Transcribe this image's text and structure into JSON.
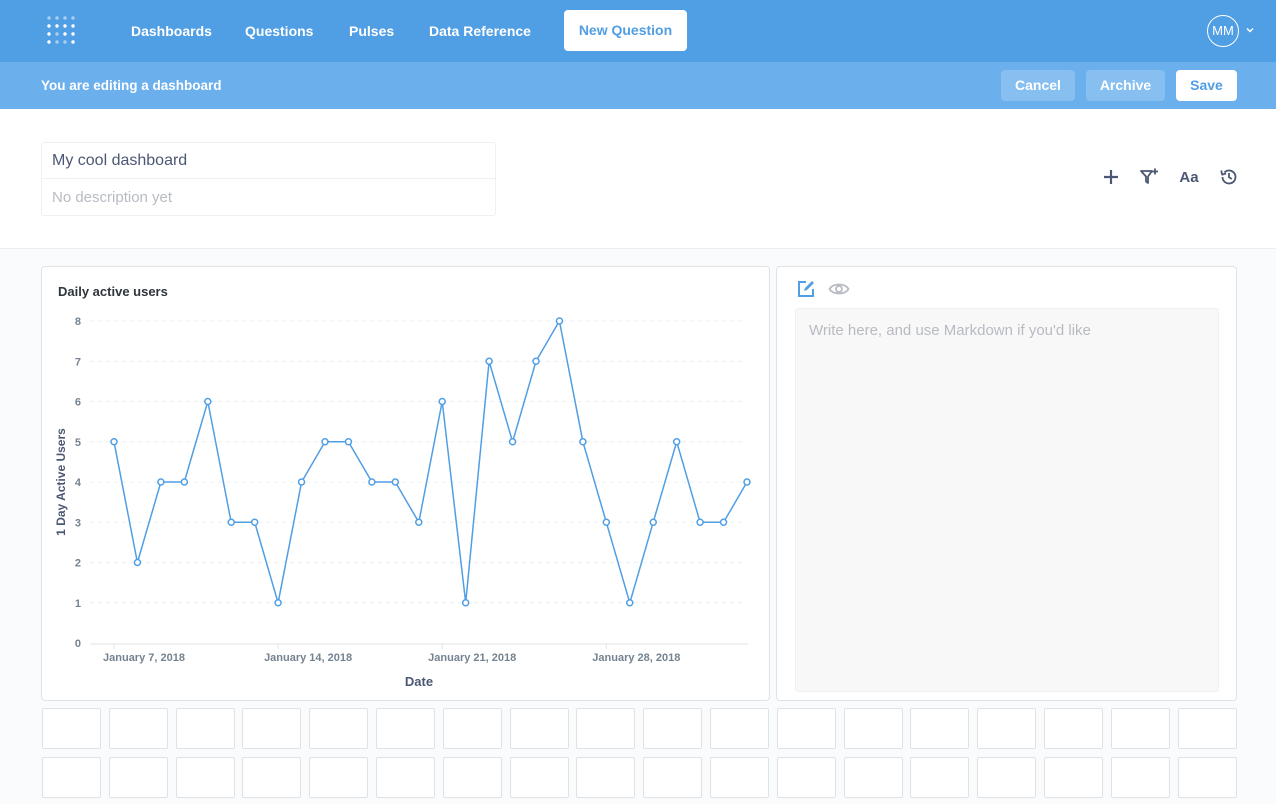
{
  "nav": {
    "links": [
      "Dashboards",
      "Questions",
      "Pulses",
      "Data Reference"
    ],
    "new_question": "New Question",
    "avatar_initials": "MM"
  },
  "editbar": {
    "message": "You are editing a dashboard",
    "cancel": "Cancel",
    "archive": "Archive",
    "save": "Save"
  },
  "header": {
    "title": "My cool dashboard",
    "description_placeholder": "No description yet",
    "text_tool_label": "Aa",
    "icons": [
      "plus-icon",
      "filter-add-icon",
      "text-icon",
      "history-icon"
    ]
  },
  "markdown_card": {
    "placeholder": "Write here, and use Markdown if you'd like"
  },
  "colors": {
    "brand": "#509ee3",
    "editbar": "#6cafed",
    "line": "#509ee3"
  },
  "chart_data": {
    "type": "line",
    "title": "Daily active users",
    "xlabel": "Date",
    "ylabel": "1 Day Active Users",
    "ylim": [
      0,
      8
    ],
    "yticks": [
      0,
      1,
      2,
      3,
      4,
      5,
      6,
      7,
      8
    ],
    "xtick_labels": [
      "January 7, 2018",
      "January 14, 2018",
      "January 21, 2018",
      "January 28, 2018"
    ],
    "x": [
      "2018-01-07",
      "2018-01-08",
      "2018-01-09",
      "2018-01-10",
      "2018-01-11",
      "2018-01-12",
      "2018-01-13",
      "2018-01-14",
      "2018-01-15",
      "2018-01-16",
      "2018-01-17",
      "2018-01-18",
      "2018-01-19",
      "2018-01-20",
      "2018-01-21",
      "2018-01-22",
      "2018-01-23",
      "2018-01-24",
      "2018-01-25",
      "2018-01-26",
      "2018-01-27",
      "2018-01-28",
      "2018-01-29",
      "2018-01-30",
      "2018-01-31",
      "2018-02-01",
      "2018-02-02",
      "2018-02-03"
    ],
    "values": [
      5,
      2,
      4,
      4,
      6,
      3,
      3,
      1,
      4,
      5,
      5,
      4,
      4,
      3,
      6,
      1,
      7,
      5,
      7,
      8,
      5,
      3,
      1,
      3,
      5,
      3,
      3,
      4
    ],
    "grid": true
  }
}
